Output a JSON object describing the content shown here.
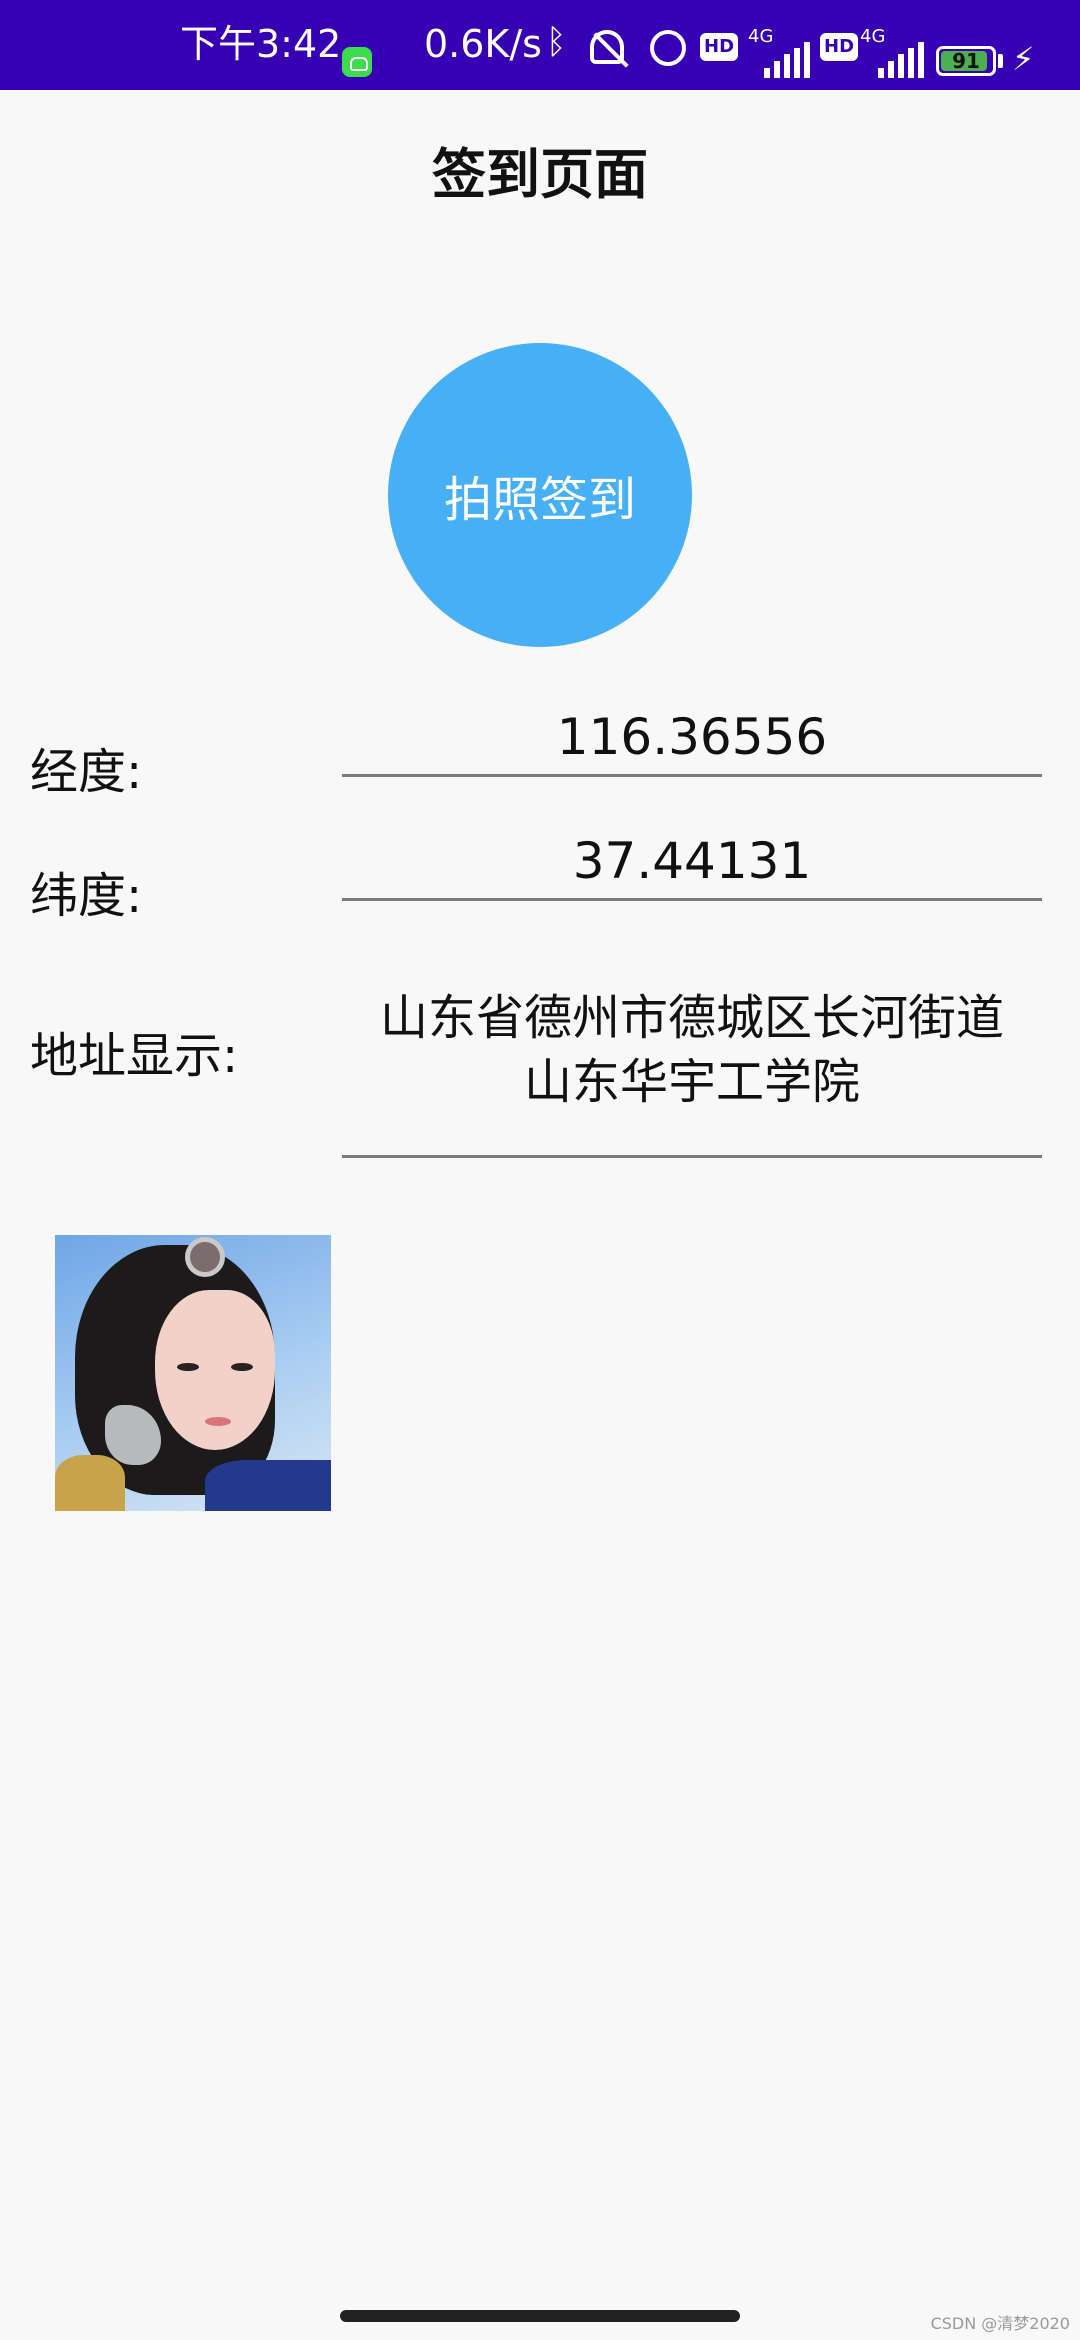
{
  "status_bar": {
    "time": "下午3:42",
    "net_speed": "0.6K/s",
    "hd_badge": "HD",
    "network_type": "4G",
    "battery_level": "91",
    "icons": [
      "app-notification-icon",
      "bluetooth-icon",
      "mute-icon",
      "alarm-icon",
      "hd-icon",
      "signal-icon",
      "battery-icon",
      "charging-icon"
    ]
  },
  "page": {
    "title": "签到页面",
    "checkin_button_label": "拍照签到",
    "button_color": "#47b0f5"
  },
  "longitude": {
    "label": "经度:",
    "value": "116.36556"
  },
  "latitude": {
    "label": "纬度:",
    "value": "37.44131"
  },
  "address": {
    "label": "地址显示:",
    "line1": "山东省德州市德城区长河街道",
    "line2": "山东华宇工学院"
  },
  "watermark": "CSDN @清梦2020",
  "colors": {
    "status_bar": "#3700b3",
    "background": "#f8f8f8"
  }
}
